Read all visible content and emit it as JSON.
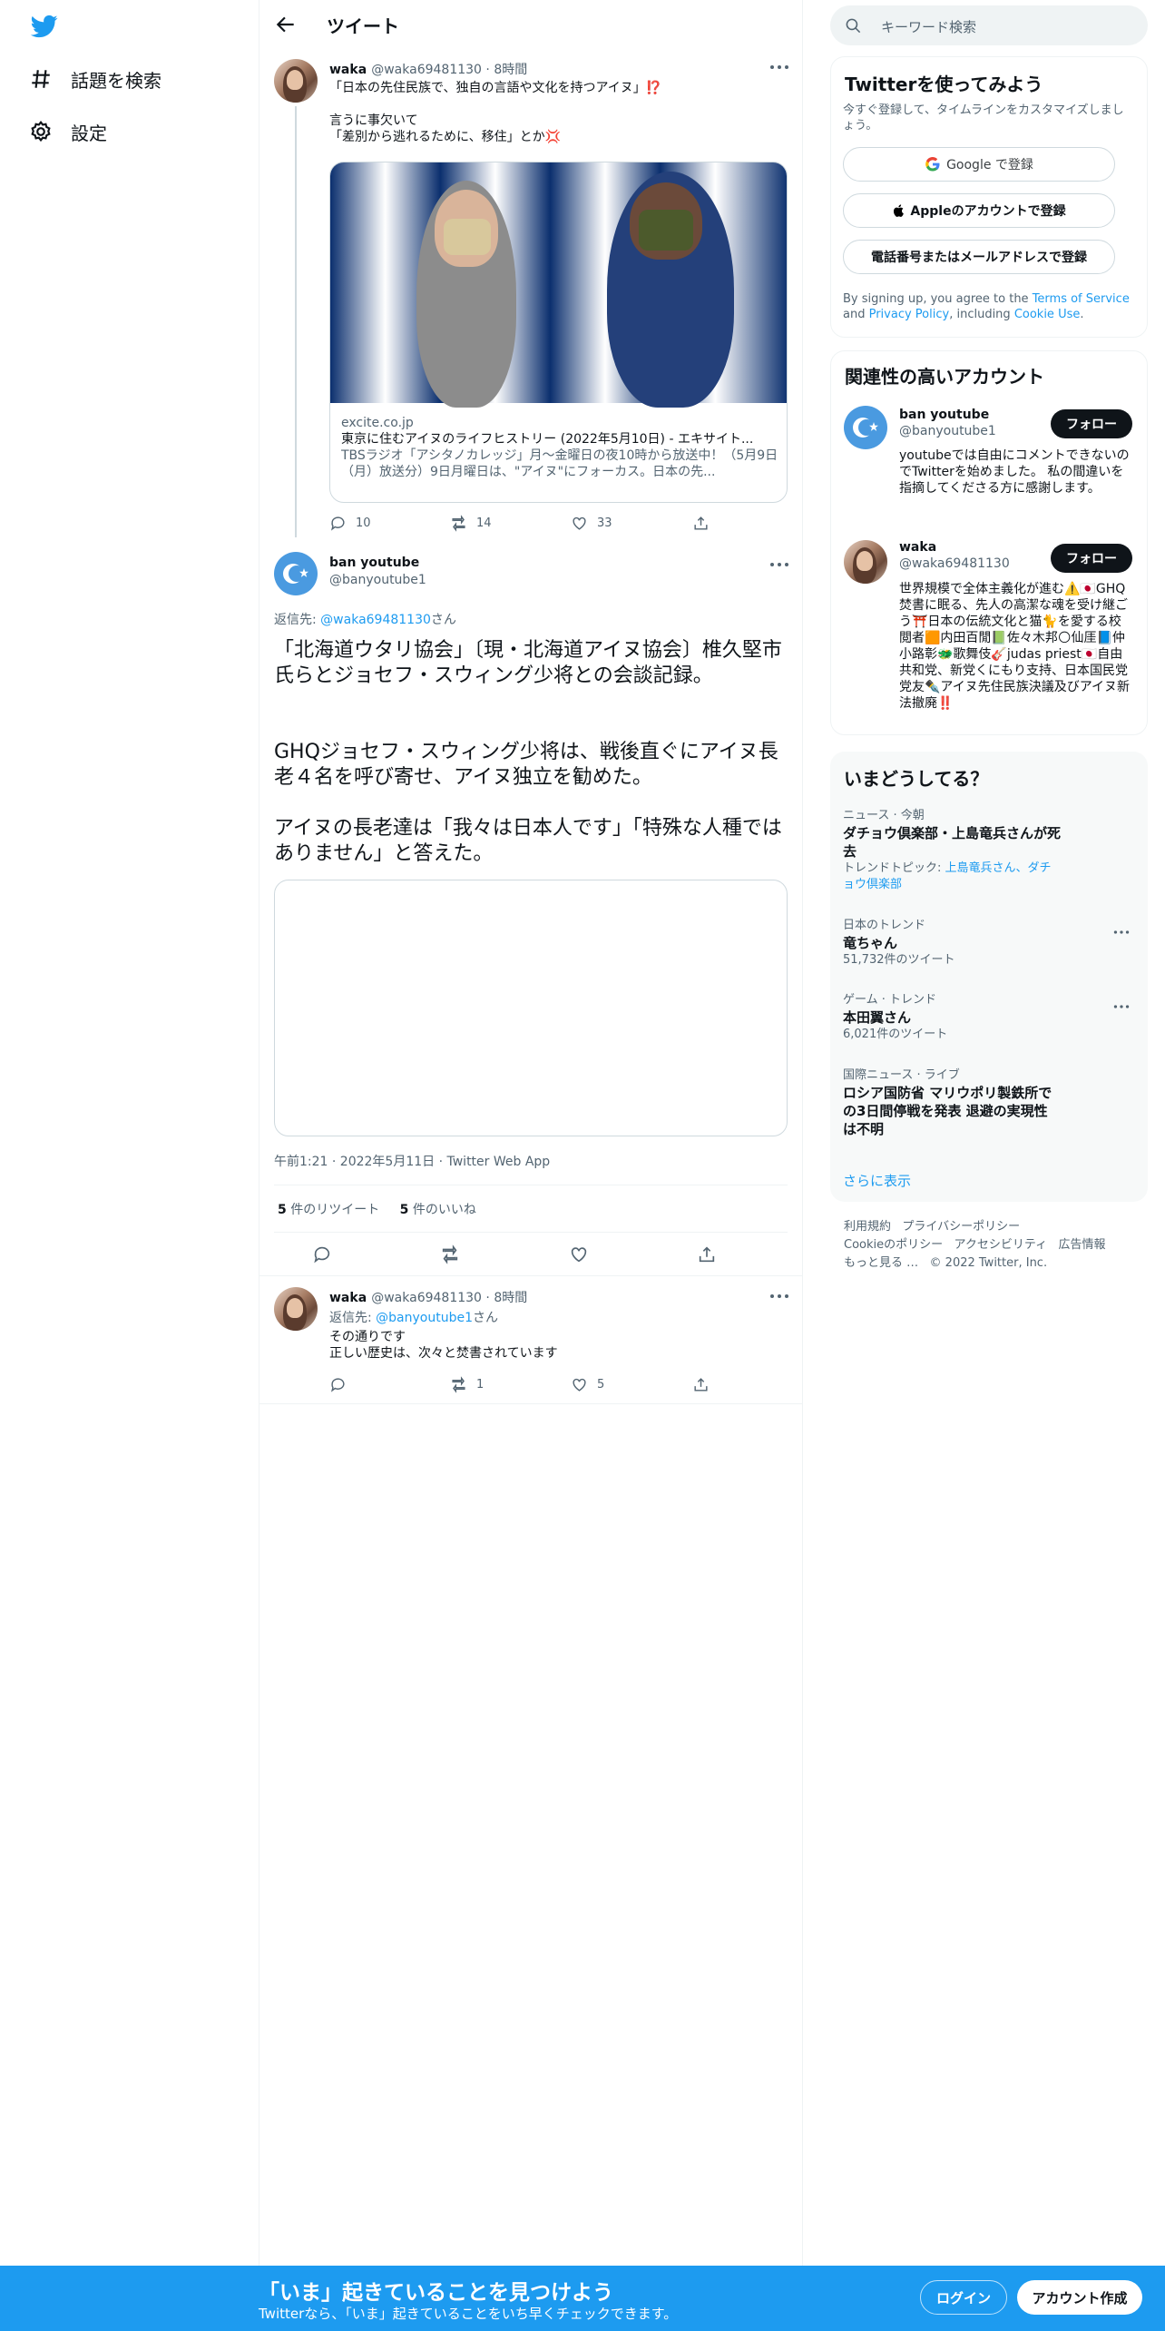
{
  "nav": {
    "explore_label": "話題を検索",
    "settings_label": "設定"
  },
  "header": {
    "title": "ツイート"
  },
  "parent_tweet": {
    "name": "waka",
    "handle_time": "@waka69481130 · 8時間",
    "line1": "「日本の先住民族で、独自の言語や文化を持つアイヌ」⁉️",
    "line2": "言うに事欠いて",
    "line3": "「差別から逃れるために、移住」とか💢",
    "card_domain": "excite.co.jp",
    "card_title": "東京に住むアイヌのライフヒストリー (2022年5月10日) - エキサイト...",
    "card_desc": "TBSラジオ「アシタノカレッジ」月～金曜日の夜10時から放送中！（5月9日（月）放送分）9日月曜日は、\"アイヌ\"にフォーカス。日本の先...",
    "replies": "10",
    "retweets": "14",
    "likes": "33"
  },
  "main_tweet": {
    "name": "ban youtube",
    "handle": "@banyoutube1",
    "reply_prefix": "返信先: ",
    "reply_handle": "@waka69481130",
    "reply_suffix": "さん",
    "para1": "「北海道ウタリ協会」〔現・北海道アイヌ協会〕椎久堅市 氏らとジョセフ・スウィング少将との会談記録。",
    "para2": "GHQジョセフ・スウィング少将は、戦後直ぐにアイヌ長老４名を呼び寄せ、アイヌ独立を勧めた。",
    "para3": "アイヌの長老達は「我々は日本人です」「特殊な人種ではありません」と答えた。",
    "timestamp": "午前1:21 · 2022年5月11日 · Twitter Web App",
    "retweet_count": "5",
    "retweet_label": " 件のリツイート",
    "like_count": "5",
    "like_label": " 件のいいね"
  },
  "reply_tweet": {
    "name": "waka",
    "handle_time": "@waka69481130 · 8時間",
    "reply_prefix": "返信先: ",
    "reply_handle": "@banyoutube1",
    "reply_suffix": "さん",
    "line1": "その通りです",
    "line2": "正しい歴史は、次々と焚書されています",
    "retweets": "1",
    "likes": "5"
  },
  "search": {
    "placeholder": "キーワード検索"
  },
  "signup": {
    "title": "Twitterを使ってみよう",
    "subtitle": "今すぐ登録して、タイムラインをカスタマイズしましょう。",
    "google_btn": "Google で登録",
    "apple_btn": "Appleのアカウントで登録",
    "phone_btn": "電話番号またはメールアドレスで登録",
    "terms_pre": "By signing up, you agree to the ",
    "terms_link": "Terms of Service",
    "terms_mid": " and ",
    "privacy_link": "Privacy Policy",
    "terms_mid2": ", including ",
    "cookie_link": "Cookie Use",
    "terms_end": "."
  },
  "related": {
    "title": "関連性の高いアカウント",
    "follow_label": "フォロー",
    "accounts": [
      {
        "name": "ban youtube",
        "handle": "@banyoutube1",
        "bio": "youtubeでは自由にコメントできないのでTwitterを始めました。 私の間違いを指摘してくださる方に感謝します。"
      },
      {
        "name": "waka",
        "handle": "@waka69481130",
        "bio": "世界規模で全体主義化が進む⚠️🇯🇵GHQ焚書に眠る、先人の高潔な魂を受け継ごう⛩️日本の伝統文化と猫🐈を愛する校閲者🟧内田百閒📗佐々木邦🌕仙厓📘仲小路彰🐲歌舞伎🎸judas priest🇯🇵自由共和党、新党くにもり支持、日本国民党党友✒️アイヌ先住民族決議及びアイヌ新法撤廃‼️"
      }
    ]
  },
  "trends": {
    "title": "いまどうしてる？",
    "items": [
      {
        "category": "ニュース · 今朝",
        "name": "ダチョウ倶楽部・上島竜兵さんが死去",
        "topic_prefix": "トレンドトピック: ",
        "topic_link": "上島竜兵さん、ダチョウ倶楽部"
      },
      {
        "category": "日本のトレンド",
        "name": "竜ちゃん",
        "count": "51,732件のツイート"
      },
      {
        "category": "ゲーム · トレンド",
        "name": "本田翼さん",
        "count": "6,021件のツイート"
      },
      {
        "category": "国際ニュース · ライブ",
        "name": "ロシア国防省 マリウポリ製鉄所での3日間停戦を発表 退避の実現性は不明"
      }
    ],
    "show_more": "さらに表示"
  },
  "footer": {
    "terms": "利用規約",
    "privacy": "プライバシーポリシー",
    "cookie": "Cookieのポリシー",
    "accessibility": "アクセシビリティ",
    "ads": "広告情報",
    "more": "もっと見る …",
    "copyright": "© 2022 Twitter, Inc."
  },
  "bottom_bar": {
    "title": "「いま」起きていることを見つけよう",
    "subtitle": "Twitterなら、「いま」起きていることをいち早くチェックできます。",
    "login": "ログイン",
    "signup": "アカウント作成"
  },
  "colors": {
    "accent": "#1d9bf0",
    "text": "#0f1419",
    "secondary": "#536471",
    "border": "#eff3f4"
  }
}
